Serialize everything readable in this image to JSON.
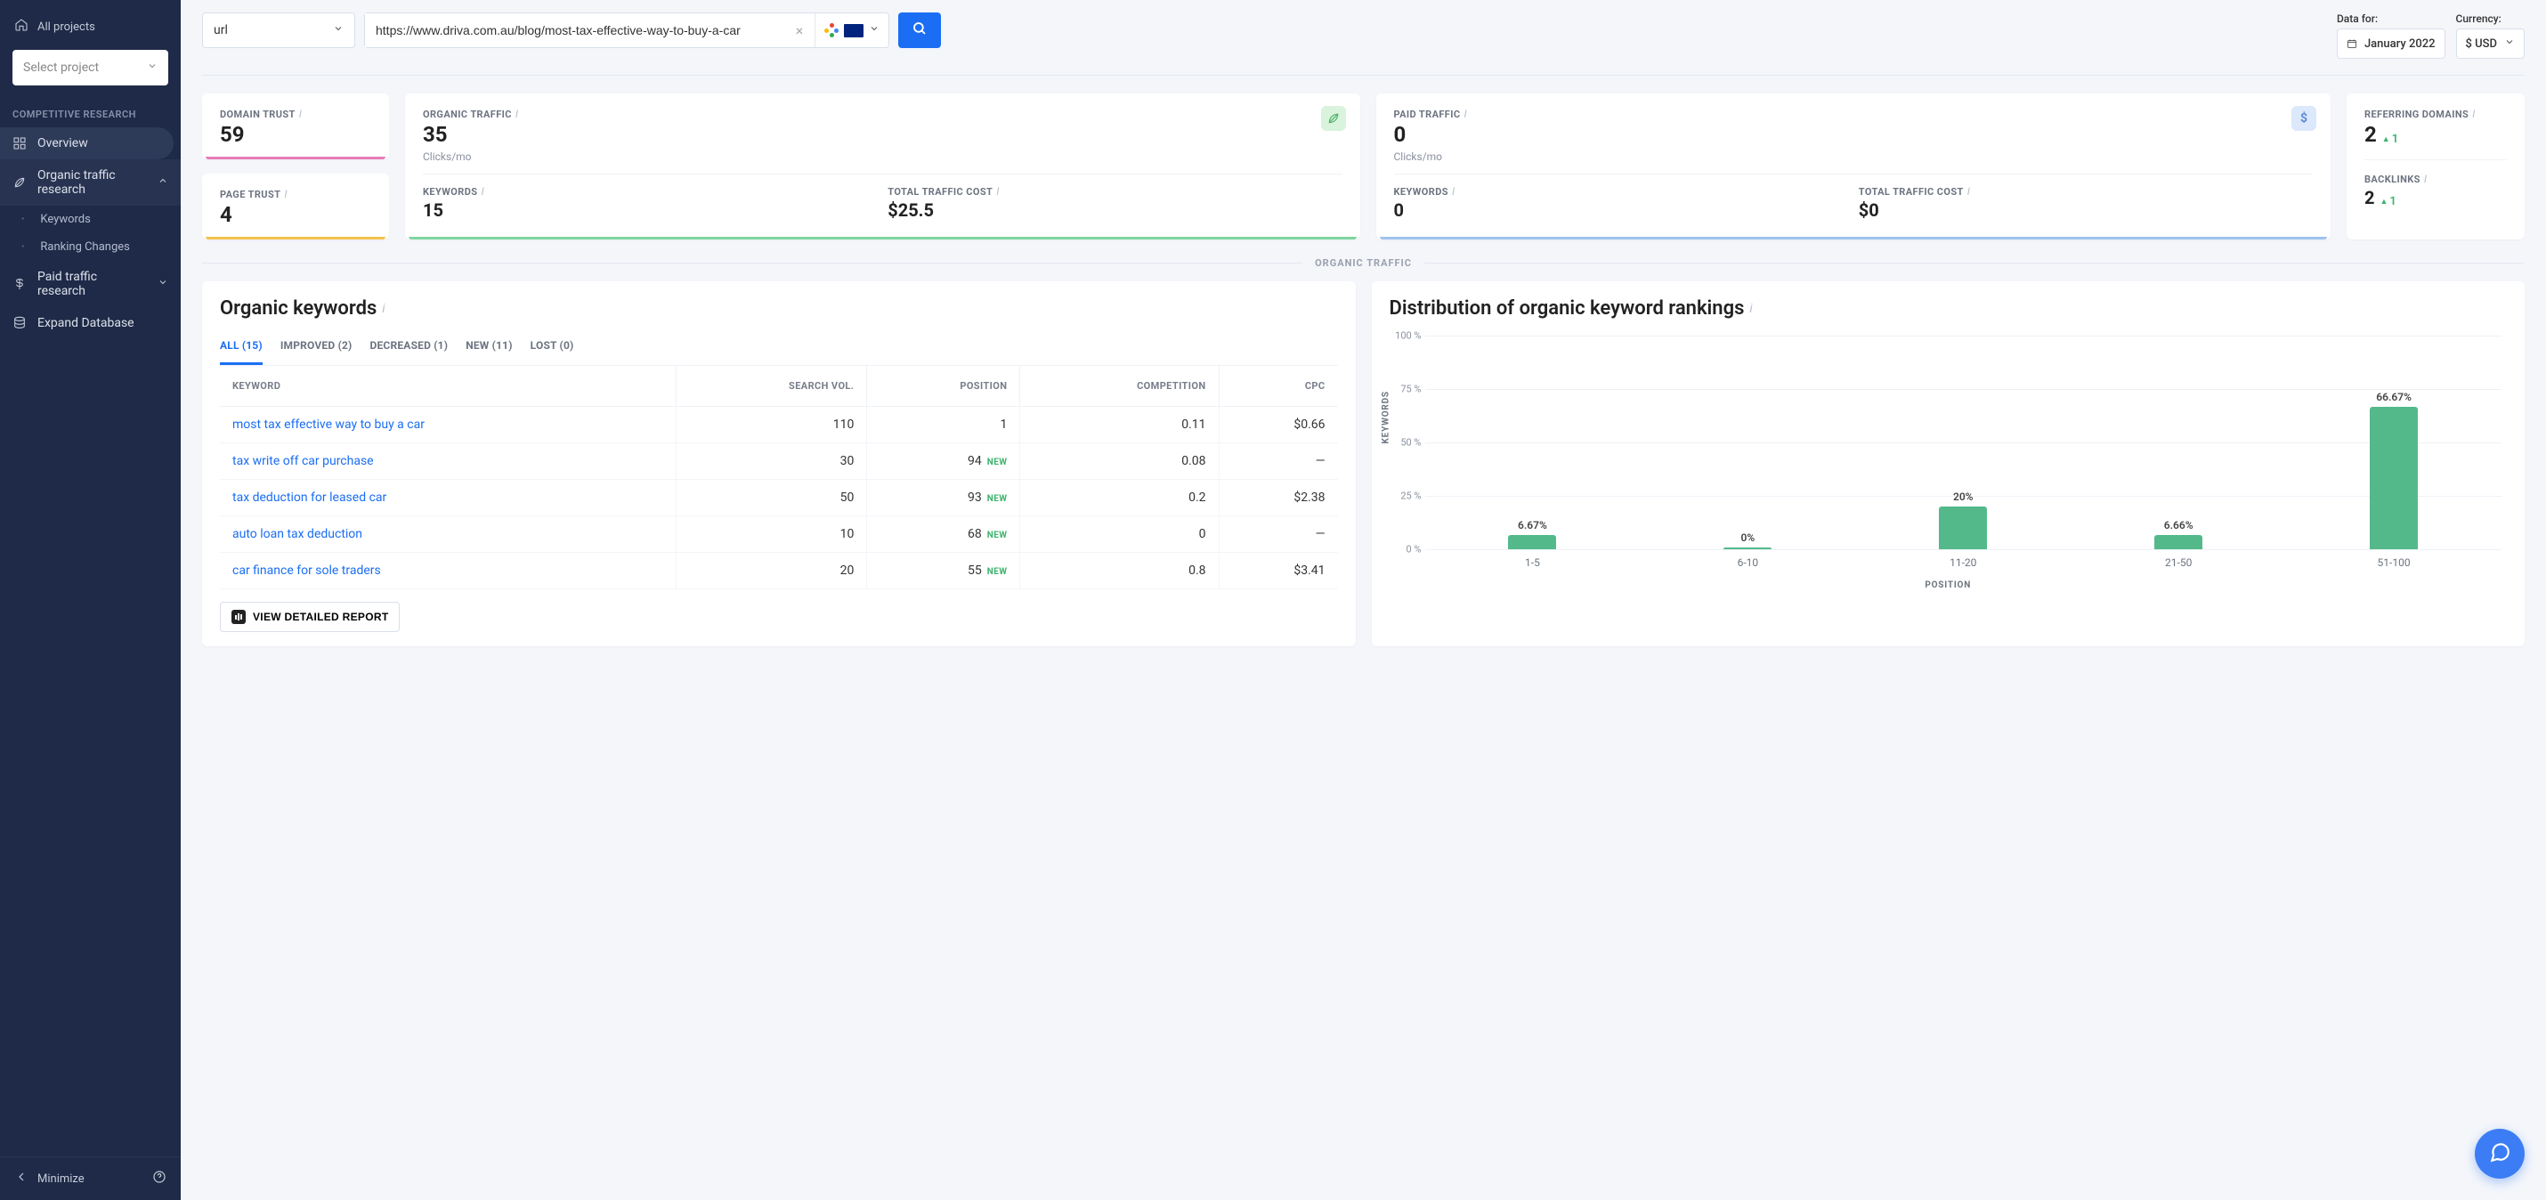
{
  "sidebar": {
    "all_projects": "All projects",
    "select_placeholder": "Select project",
    "section_label": "COMPETITIVE RESEARCH",
    "overview": "Overview",
    "organic_traffic_research": "Organic traffic research",
    "keywords": "Keywords",
    "ranking_changes": "Ranking Changes",
    "paid_traffic_research": "Paid traffic research",
    "expand_database": "Expand Database",
    "minimize": "Minimize"
  },
  "topbar": {
    "scope": "url",
    "url_value": "https://www.driva.com.au/blog/most-tax-effective-way-to-buy-a-car",
    "data_for_label": "Data for:",
    "date_value": "January 2022",
    "currency_label": "Currency:",
    "currency_value": "$ USD"
  },
  "cards": {
    "domain_trust": {
      "label": "DOMAIN TRUST",
      "value": "59"
    },
    "page_trust": {
      "label": "PAGE TRUST",
      "value": "4"
    },
    "organic_traffic": {
      "label": "ORGANIC TRAFFIC",
      "value": "35",
      "sub": "Clicks/mo",
      "keywords_label": "KEYWORDS",
      "keywords_value": "15",
      "ttc_label": "TOTAL TRAFFIC COST",
      "ttc_value": "$25.5"
    },
    "paid_traffic": {
      "label": "PAID TRAFFIC",
      "value": "0",
      "sub": "Clicks/mo",
      "keywords_label": "KEYWORDS",
      "keywords_value": "0",
      "ttc_label": "TOTAL TRAFFIC COST",
      "ttc_value": "$0"
    },
    "referring_domains": {
      "label": "REFERRING DOMAINS",
      "value": "2",
      "delta": "1",
      "backlinks_label": "BACKLINKS",
      "backlinks_value": "2",
      "backlinks_delta": "1"
    }
  },
  "section_organic_traffic": "ORGANIC TRAFFIC",
  "organic_keywords": {
    "title": "Organic keywords",
    "tabs": {
      "all": "ALL (15)",
      "improved": "IMPROVED (2)",
      "decreased": "DECREASED (1)",
      "new": "NEW (11)",
      "lost": "LOST (0)"
    },
    "headers": {
      "keyword": "KEYWORD",
      "search_vol": "SEARCH VOL.",
      "position": "POSITION",
      "competition": "COMPETITION",
      "cpc": "CPC"
    },
    "new_badge": "NEW",
    "rows": [
      {
        "keyword": "most tax effective way to buy a car",
        "vol": "110",
        "pos": "1",
        "pos_new": false,
        "comp": "0.11",
        "cpc": "$0.66"
      },
      {
        "keyword": "tax write off car purchase",
        "vol": "30",
        "pos": "94",
        "pos_new": true,
        "comp": "0.08",
        "cpc": "—"
      },
      {
        "keyword": "tax deduction for leased car",
        "vol": "50",
        "pos": "93",
        "pos_new": true,
        "comp": "0.2",
        "cpc": "$2.38"
      },
      {
        "keyword": "auto loan tax deduction",
        "vol": "10",
        "pos": "68",
        "pos_new": true,
        "comp": "0",
        "cpc": "—"
      },
      {
        "keyword": "car finance for sole traders",
        "vol": "20",
        "pos": "55",
        "pos_new": true,
        "comp": "0.8",
        "cpc": "$3.41"
      }
    ],
    "view_report": "VIEW DETAILED REPORT"
  },
  "distribution": {
    "title": "Distribution of organic keyword rankings",
    "ylabel": "KEYWORDS",
    "xlabel": "POSITION"
  },
  "chart_data": {
    "type": "bar",
    "title": "Distribution of organic keyword rankings",
    "xlabel": "POSITION",
    "ylabel": "KEYWORDS",
    "y_unit": "%",
    "ylim": [
      0,
      100
    ],
    "y_ticks": [
      0,
      25,
      50,
      75,
      100
    ],
    "categories": [
      "1-5",
      "6-10",
      "11-20",
      "21-50",
      "51-100"
    ],
    "values": [
      6.67,
      0,
      20,
      6.66,
      66.67
    ],
    "value_labels": [
      "6.67%",
      "0%",
      "20%",
      "6.66%",
      "66.67%"
    ]
  }
}
